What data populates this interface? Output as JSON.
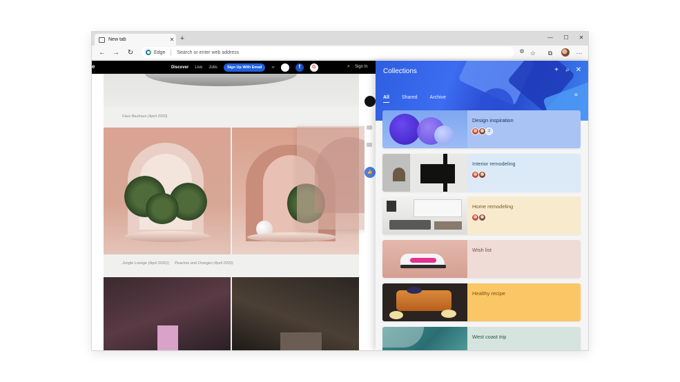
{
  "browser": {
    "tab": {
      "title": "New tab",
      "close": "✕"
    },
    "new_tab": "+",
    "window_controls": {
      "minimize": "—",
      "maximize": "☐",
      "close": "✕"
    },
    "nav": {
      "back": "←",
      "forward": "→",
      "refresh": "↻"
    },
    "address": {
      "brand": "Edge",
      "placeholder": "Search or enter web address"
    },
    "toolbar_icons": {
      "extensions": "⚙",
      "favorite": "☆",
      "collections": "⧉",
      "more": "···"
    }
  },
  "site": {
    "logo": "e",
    "links": [
      "Discover",
      "Live",
      "Jobs"
    ],
    "signup": "Sign Up With Email",
    "or": "or",
    "social": {
      "apple": "",
      "facebook": "f",
      "google": "G"
    },
    "search_icon": "⌕",
    "signin": "Sign In",
    "captions": {
      "top": "Faux Bauhaus (April 2020)",
      "left": "Jungle Lounge (April 2020)",
      "sep": "|",
      "right": "Peaches and Oranges (April 2020)"
    }
  },
  "collections": {
    "title": "Collections",
    "actions": {
      "add": "+",
      "search": "⌕",
      "close": "✕",
      "menu": "≡"
    },
    "tabs": [
      "All",
      "Shared",
      "Archive"
    ],
    "active_tab": "All",
    "cards": [
      {
        "title": "Design inspiration",
        "bg": "#a9c3f5",
        "title_color": "#1f2d55",
        "shared": true,
        "count": "2"
      },
      {
        "title": "Interior remodeling",
        "bg": "#dceaf8",
        "title_color": "#1f4e6e",
        "shared": true,
        "count": ""
      },
      {
        "title": "Home remodeling",
        "bg": "#f8ebcd",
        "title_color": "#7a5a1a",
        "shared": true,
        "count": ""
      },
      {
        "title": "Wish list",
        "bg": "#efdcd6",
        "title_color": "#7a4a42",
        "shared": false,
        "count": ""
      },
      {
        "title": "Healthy recipe",
        "bg": "#fbc666",
        "title_color": "#7a4f0a",
        "shared": false,
        "count": ""
      },
      {
        "title": "West coast trip",
        "bg": "#d6e4df",
        "title_color": "#2a5248",
        "shared": false,
        "count": ""
      }
    ]
  }
}
